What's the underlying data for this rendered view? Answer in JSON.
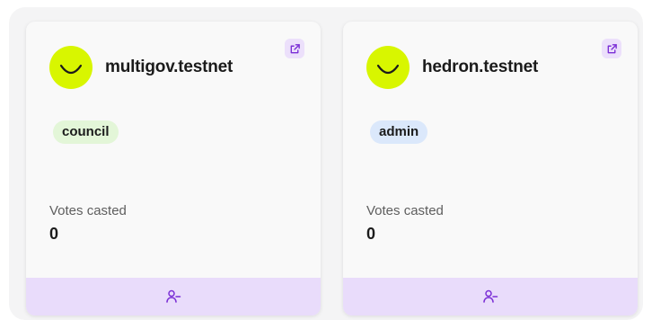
{
  "colors": {
    "avatar": "#d8f600",
    "accent_purple": "#7b2fd6",
    "footer_bg": "#e9dcfb",
    "council_badge": "#e3f6d8",
    "admin_badge": "#dbe8fb"
  },
  "cards": [
    {
      "name": "multigov.testnet",
      "role": "council",
      "votes_label": "Votes casted",
      "votes_value": "0",
      "icons": {
        "external": "external-link-icon",
        "avatar": "smile-avatar-icon",
        "footer": "remove-user-icon"
      }
    },
    {
      "name": "hedron.testnet",
      "role": "admin",
      "votes_label": "Votes casted",
      "votes_value": "0",
      "icons": {
        "external": "external-link-icon",
        "avatar": "smile-avatar-icon",
        "footer": "remove-user-icon"
      }
    }
  ]
}
